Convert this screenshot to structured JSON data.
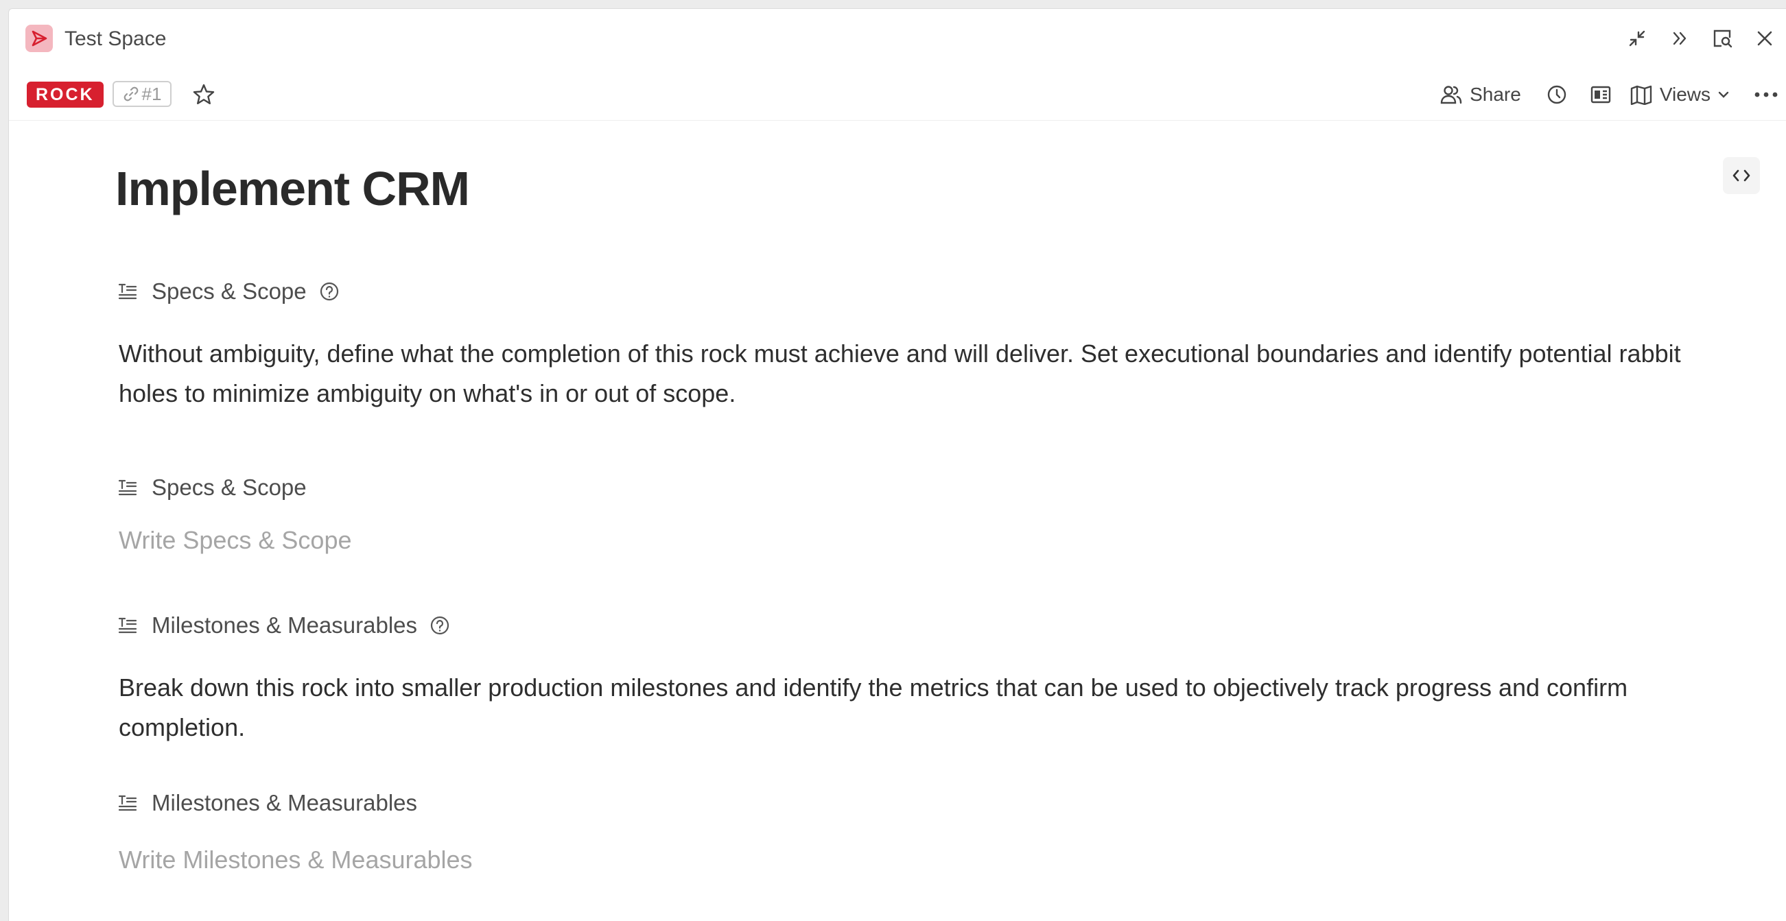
{
  "header": {
    "space_name": "Test Space",
    "badge": "ROCK",
    "link_id": "#1",
    "share_label": "Share",
    "views_label": "Views",
    "accent": "#d7202f"
  },
  "document": {
    "title": "Implement CRM",
    "sections": [
      {
        "label": "Specs & Scope",
        "text": "Without ambiguity, define what the completion of this rock must achieve and will deliver. Set executional boundaries and identify potential rabbit holes to minimize ambiguity on what's in or out of scope."
      },
      {
        "label": "Specs & Scope",
        "placeholder": "Write Specs & Scope"
      },
      {
        "label": "Milestones & Measurables",
        "text": "Break down this rock into smaller production milestones and  identify the metrics that can be used to objectively track progress and confirm completion."
      },
      {
        "label": "Milestones & Measurables",
        "placeholder": "Write Milestones & Measurables"
      }
    ]
  }
}
